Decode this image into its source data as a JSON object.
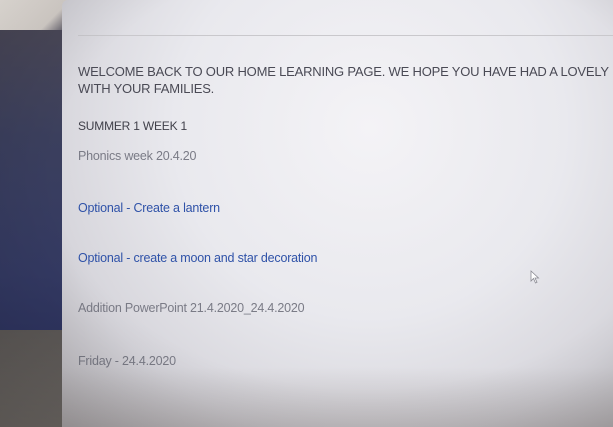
{
  "page": {
    "welcome_line1": "WELCOME BACK TO OUR HOME LEARNING PAGE. WE HOPE YOU HAVE HAD A LOVELY BRE",
    "welcome_line2": "WITH YOUR FAMILIES.",
    "week_title": "SUMMER 1 WEEK 1"
  },
  "links": [
    {
      "label": "Phonics week 20.4.20",
      "color": "#7a7b86"
    },
    {
      "label": "Optional - Create a lantern",
      "color": "#2f52a8"
    },
    {
      "label": "Optional - create a moon and star decoration",
      "color": "#2f52a8"
    },
    {
      "label": "Addition PowerPoint 21.4.2020_24.4.2020",
      "color": "#7a7b86"
    },
    {
      "label": "Friday - 24.4.2020",
      "color": "#7a7b86"
    }
  ],
  "icons": {
    "cursor": "mouse-pointer-icon"
  },
  "colors": {
    "sidebar": "#343a63",
    "link_blue": "#2f52a8",
    "link_grey": "#7a7b86",
    "text": "#4a4a55"
  }
}
